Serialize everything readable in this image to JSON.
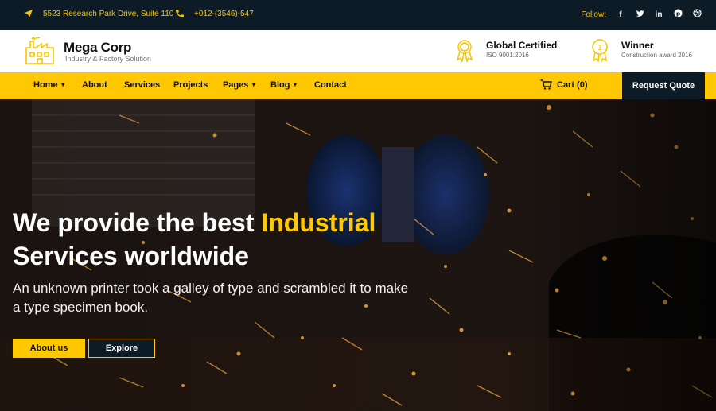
{
  "topbar": {
    "address": "5523 Research Park Drive, Suite 110",
    "phone": "+012-(3546)-547",
    "follow_label": "Follow:",
    "social": [
      "f",
      "t",
      "in",
      "p",
      "d"
    ]
  },
  "header": {
    "brand": "Mega Corp",
    "tagline": "Industry & Factory Solution",
    "badges": [
      {
        "title": "Global Certified",
        "subtitle": "ISO 9001:2016"
      },
      {
        "title": "Winner",
        "subtitle": "Construction award 2016",
        "icon_text": "1"
      }
    ]
  },
  "nav": {
    "items": [
      "Home",
      "About",
      "Services",
      "Projects",
      "Pages",
      "Blog",
      "Contact"
    ],
    "cart_label": "Cart (0)",
    "quote_button": "Request Quote"
  },
  "hero": {
    "title_part1": "We provide the best ",
    "title_highlight": "Industrial",
    "title_part2": "Services worldwide",
    "subtitle": "An unknown printer took a galley of type and scrambled it to make a type specimen book.",
    "primary_button": "About us",
    "secondary_button": "Explore"
  },
  "colors": {
    "accent": "#ffc800",
    "dark": "#0d1b26"
  }
}
